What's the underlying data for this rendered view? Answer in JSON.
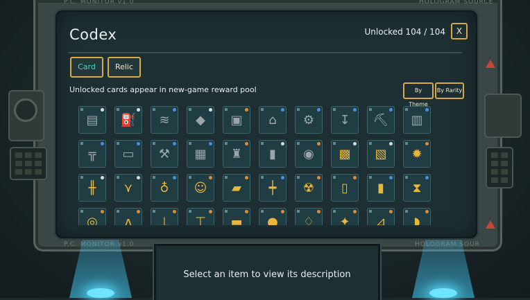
{
  "labels": {
    "monitor_top": "P.C. MONITOR v1.0",
    "hologram_top": "HOLOGRAM SOURCE",
    "monitor_bottom": "P.C. MONITOR v1.0",
    "hologram_bottom": "HOLOGRAM SOUR"
  },
  "codex": {
    "title": "Codex",
    "unlocked": "Unlocked 104 / 104",
    "close_label": "X",
    "tabs": [
      {
        "label": "Card",
        "active": true
      },
      {
        "label": "Relic",
        "active": false
      }
    ],
    "hint": "Unlocked cards appear in new-game reward pool",
    "sort_buttons": [
      "By Theme",
      "By Rarity"
    ]
  },
  "colors": {
    "accent_gold": "#d7a94a",
    "tab_active_text": "#49d3c6",
    "rarity_common": "#d9dde0",
    "rarity_rare": "#4a8ee8",
    "rarity_epic": "#e8882e"
  },
  "cards": [
    [
      {
        "icon": "document-icon",
        "tone": "gray",
        "rarity": "common"
      },
      {
        "icon": "oil-pump-icon",
        "tone": "gray",
        "rarity": "common"
      },
      {
        "icon": "spring-icon",
        "tone": "gray",
        "rarity": "rare"
      },
      {
        "icon": "crystal-icon",
        "tone": "gray",
        "rarity": "common"
      },
      {
        "icon": "ore-cart-icon",
        "tone": "gray",
        "rarity": "epic"
      },
      {
        "icon": "factory-icon",
        "tone": "gray",
        "rarity": "rare"
      },
      {
        "icon": "engine-icon",
        "tone": "gray",
        "rarity": "rare"
      },
      {
        "icon": "drill-icon",
        "tone": "gray",
        "rarity": "rare"
      },
      {
        "icon": "excavator-icon",
        "tone": "gray",
        "rarity": "rare"
      },
      {
        "icon": "building-icon",
        "tone": "gray",
        "rarity": "rare"
      }
    ],
    [
      {
        "icon": "press-machine-icon",
        "tone": "gray",
        "rarity": "rare"
      },
      {
        "icon": "assembly-line-icon",
        "tone": "gray",
        "rarity": "rare"
      },
      {
        "icon": "wrench-icon",
        "tone": "gray",
        "rarity": "rare"
      },
      {
        "icon": "circuit-board-icon",
        "tone": "gray",
        "rarity": "rare"
      },
      {
        "icon": "refinery-icon",
        "tone": "gray",
        "rarity": "epic"
      },
      {
        "icon": "skyscraper-icon",
        "tone": "gray",
        "rarity": "common"
      },
      {
        "icon": "cement-mixer-icon",
        "tone": "gray",
        "rarity": "epic"
      },
      {
        "icon": "gold-safe-icon",
        "tone": "gold",
        "rarity": "common"
      },
      {
        "icon": "solar-panel-icon",
        "tone": "gold",
        "rarity": "common"
      },
      {
        "icon": "sun-gear-icon",
        "tone": "gold",
        "rarity": "epic"
      }
    ],
    [
      {
        "icon": "pylon-icon",
        "tone": "gold",
        "rarity": "common"
      },
      {
        "icon": "robot-arm-icon",
        "tone": "gold",
        "rarity": "common"
      },
      {
        "icon": "lightbulb-icon",
        "tone": "gold",
        "rarity": "rare"
      },
      {
        "icon": "robot-head-icon",
        "tone": "gold",
        "rarity": "epic"
      },
      {
        "icon": "gold-bars-icon",
        "tone": "gold",
        "rarity": "epic"
      },
      {
        "icon": "lamp-post-icon",
        "tone": "gold",
        "rarity": "rare"
      },
      {
        "icon": "reactor-icon",
        "tone": "gold",
        "rarity": "epic"
      },
      {
        "icon": "barrel-icon",
        "tone": "gold",
        "rarity": "epic"
      },
      {
        "icon": "battery-icon",
        "tone": "gold",
        "rarity": "rare"
      },
      {
        "icon": "hourglass-icon",
        "tone": "gold",
        "rarity": "rare"
      }
    ],
    [
      {
        "icon": "radar-icon",
        "tone": "gold",
        "rarity": "epic"
      },
      {
        "icon": "mech-legs-icon",
        "tone": "gold",
        "rarity": "epic"
      },
      {
        "icon": "antenna-icon",
        "tone": "gold",
        "rarity": "epic"
      },
      {
        "icon": "crane-icon",
        "tone": "gold",
        "rarity": "epic"
      },
      {
        "icon": "bulldozer-icon",
        "tone": "gold",
        "rarity": "epic"
      },
      {
        "icon": "coin-icon",
        "tone": "gold",
        "rarity": "epic"
      },
      {
        "icon": "generator-icon",
        "tone": "gold",
        "rarity": "epic"
      },
      {
        "icon": "gear-tower-icon",
        "tone": "gold",
        "rarity": "epic"
      },
      {
        "icon": "chart-icon",
        "tone": "gold",
        "rarity": "epic"
      },
      {
        "icon": "satellite-dish-icon",
        "tone": "gold",
        "rarity": "epic"
      }
    ]
  ],
  "description_prompt": "Select an item to view its description"
}
